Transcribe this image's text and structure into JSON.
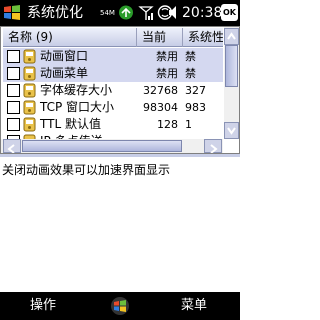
{
  "status_bar": {
    "title": "系统优化",
    "signal_text": "54M",
    "time": "20:38",
    "ok_label": "OK",
    "icons": [
      "start-logo-icon",
      "network-icon",
      "signal-icon",
      "sync-icon",
      "volume-icon"
    ]
  },
  "table": {
    "headers": {
      "name": "名称 (9)",
      "current": "当前",
      "system": "系统性"
    },
    "rows": [
      {
        "name": "动画窗口",
        "current": "禁用",
        "system": "禁",
        "checked": false,
        "selected": true
      },
      {
        "name": "动画菜单",
        "current": "禁用",
        "system": "禁",
        "checked": false,
        "selected": true
      },
      {
        "name": "字体缓存大小",
        "current": "32768",
        "system": "327",
        "checked": false,
        "selected": false
      },
      {
        "name": "TCP 窗口大小",
        "current": "98304",
        "system": "983",
        "checked": false,
        "selected": false
      },
      {
        "name": "TTL 默认值",
        "current": "128",
        "system": "1",
        "checked": false,
        "selected": false
      },
      {
        "name": "IP 多点传送",
        "current": "…",
        "system": "",
        "checked": false,
        "selected": false
      }
    ]
  },
  "description": "关闭动画效果可以加速界面显示",
  "softkeys": {
    "left": "操作",
    "right": "菜单"
  },
  "colors": {
    "header_bg": "#c7cde6",
    "selected_row": "#d4d8f0",
    "bar_bg": "#000000"
  }
}
